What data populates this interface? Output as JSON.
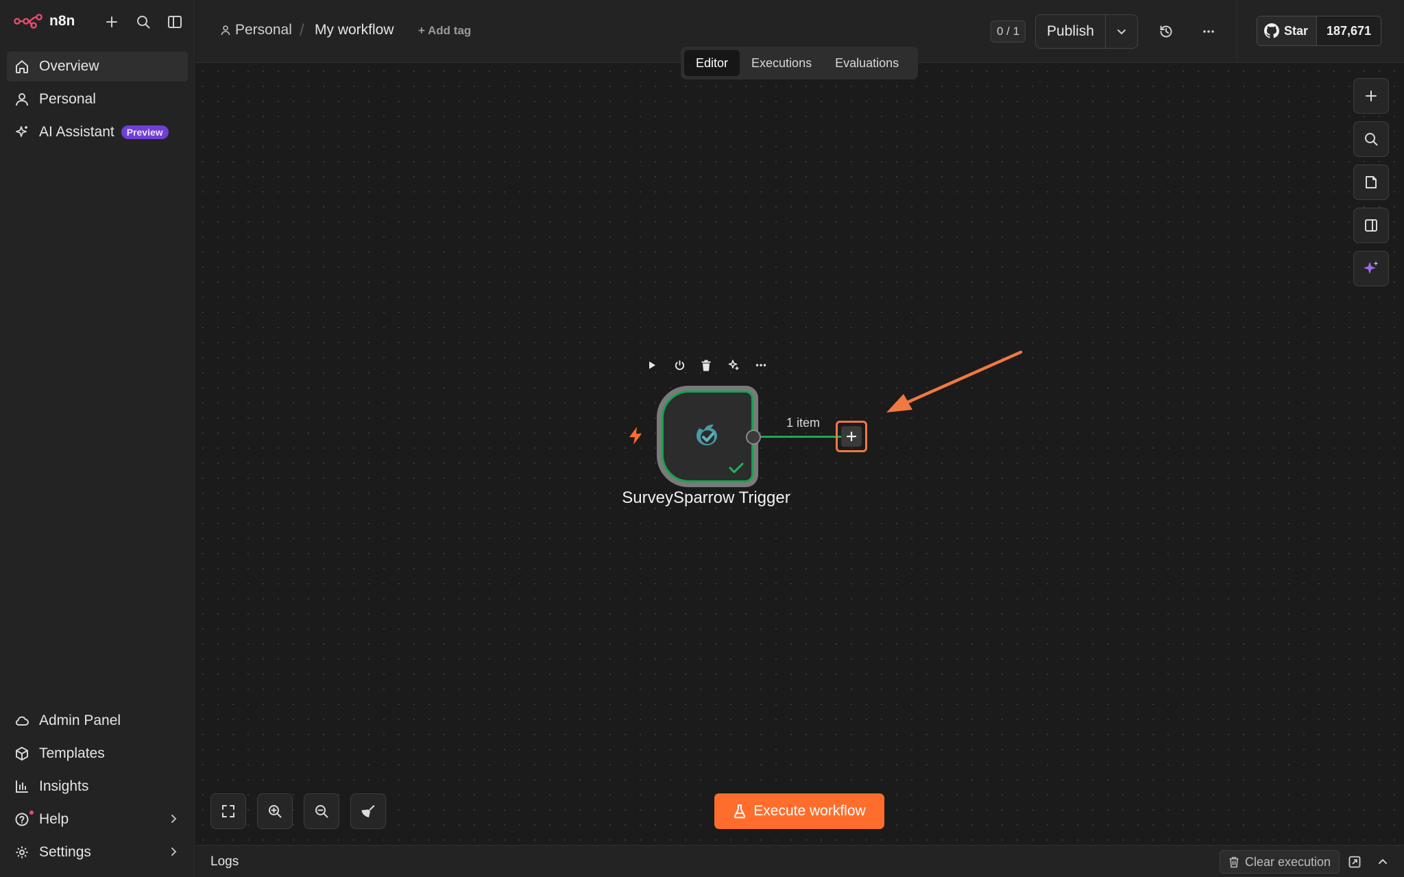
{
  "app": {
    "name": "n8n"
  },
  "sidebar": {
    "items": [
      {
        "label": "Overview",
        "icon": "home-icon",
        "active": true
      },
      {
        "label": "Personal",
        "icon": "user-icon"
      },
      {
        "label": "AI Assistant",
        "icon": "sparkles-icon",
        "badge": "Preview"
      }
    ],
    "bottom_items": [
      {
        "label": "Admin Panel",
        "icon": "cloud-icon"
      },
      {
        "label": "Templates",
        "icon": "box-icon"
      },
      {
        "label": "Insights",
        "icon": "bar-chart-icon"
      },
      {
        "label": "Help",
        "icon": "help-circle-icon"
      },
      {
        "label": "Settings",
        "icon": "gear-icon"
      }
    ]
  },
  "header": {
    "breadcrumb_project": "Personal",
    "workflow_name": "My workflow",
    "add_tag": "+ Add tag",
    "counter": "0 / 1",
    "publish_label": "Publish",
    "github": {
      "star_label": "Star",
      "count": "187,671"
    }
  },
  "tabs": [
    {
      "label": "Editor",
      "active": true
    },
    {
      "label": "Executions"
    },
    {
      "label": "Evaluations"
    }
  ],
  "canvas": {
    "node": {
      "name": "SurveySparrow Trigger",
      "status": "success"
    },
    "connection_label": "1 item",
    "execute_label": "Execute workflow"
  },
  "logs": {
    "label": "Logs",
    "clear_label": "Clear execution"
  },
  "colors": {
    "accent": "#ff6d2c",
    "success": "#14a44d",
    "badge": "#6f3fd6",
    "annotation": "#f07843"
  }
}
